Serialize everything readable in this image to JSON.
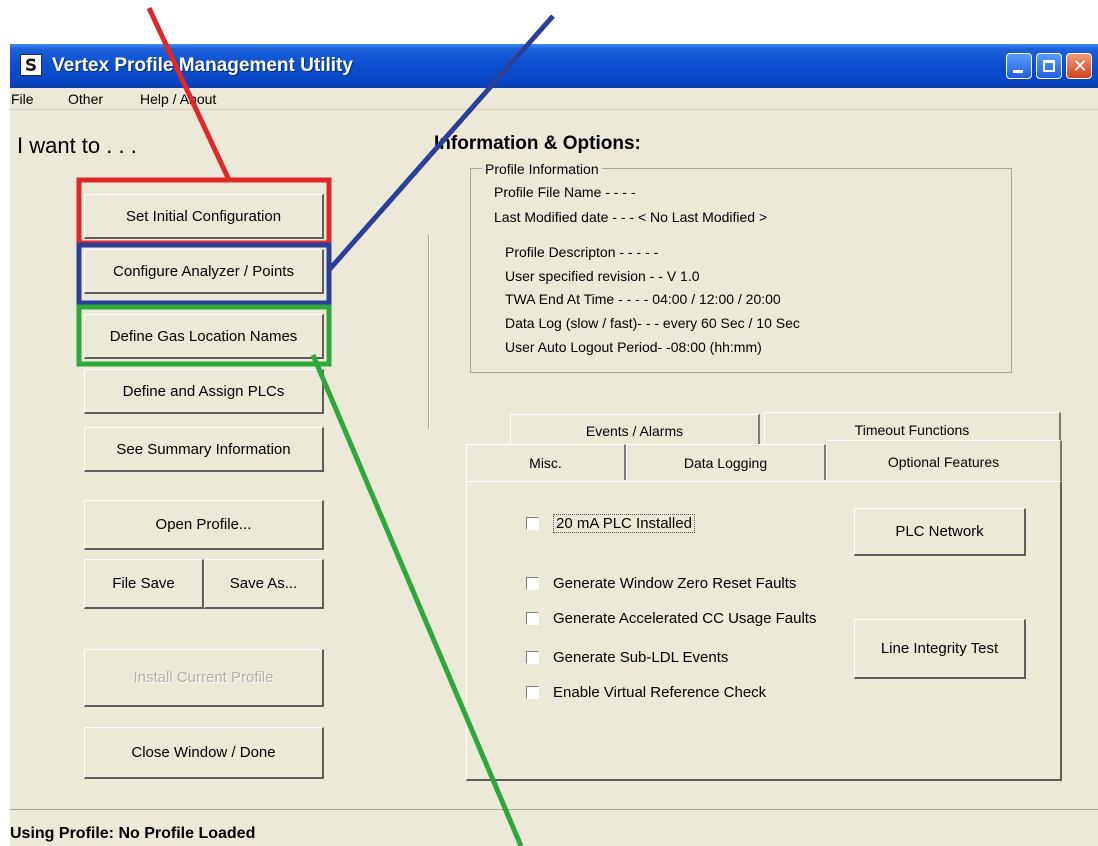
{
  "window": {
    "title": "Vertex Profile Management Utility",
    "app_icon": "vertex-logo-icon",
    "controls": [
      "minimize-icon",
      "maximize-icon",
      "close-icon"
    ]
  },
  "menu": {
    "items": [
      "File",
      "Other",
      "Help / About"
    ]
  },
  "left_panel": {
    "heading": "I want to . . .",
    "buttons": {
      "set_initial": "Set Initial Configuration",
      "configure_analyzer": "Configure Analyzer / Points",
      "define_gas": "Define Gas Location Names",
      "define_plcs": "Define and Assign PLCs",
      "summary": "See Summary Information",
      "open_profile": "Open Profile...",
      "file_save": "File Save",
      "save_as": "Save As...",
      "install_profile": "Install Current Profile",
      "close_window": "Close Window / Done"
    }
  },
  "info": {
    "heading": "Information & Options:",
    "group_title": "Profile Information",
    "file_name": "Profile File Name - - - -",
    "last_modified": "Last Modified date - - -   < No Last Modified >",
    "description": "Profile Descripton - - - - -",
    "revision": "User specified revision  - - V 1.0",
    "twa": "TWA End At Time  - - - -  04:00  /  12:00  /  20:00",
    "data_log": "Data  Log (slow / fast)-  - - every 60 Sec / 10 Sec",
    "auto_logout": "User Auto Logout Period-  -08:00 (hh:mm)"
  },
  "tabs": {
    "row1": [
      "Events / Alarms",
      "Timeout Functions"
    ],
    "row2": [
      "Misc.",
      "Data Logging",
      "Optional Features"
    ],
    "active": "Optional Features"
  },
  "optional_features": {
    "checkboxes": [
      {
        "label": "20 mA PLC Installed",
        "checked": false
      },
      {
        "label": "Generate Window Zero Reset Faults",
        "checked": false
      },
      {
        "label": "Generate Accelerated CC Usage Faults",
        "checked": false
      },
      {
        "label": "Generate Sub-LDL Events",
        "checked": false
      },
      {
        "label": "Enable Virtual Reference Check",
        "checked": false
      }
    ],
    "plc_network_button": "PLC Network",
    "line_integrity_button": "Line Integrity Test"
  },
  "status": {
    "text": "Using Profile:  No Profile Loaded"
  },
  "annotations": {
    "colors": {
      "red": "#e02626",
      "blue": "#2b3f99",
      "green": "#2ea83a"
    }
  }
}
